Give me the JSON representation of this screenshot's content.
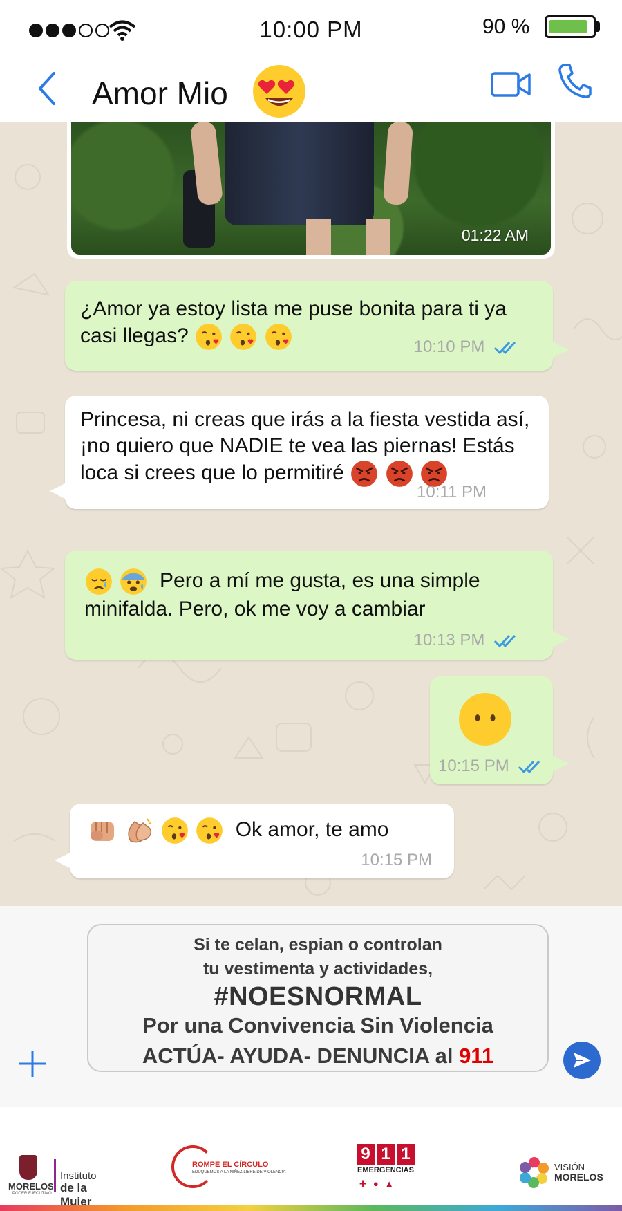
{
  "status_bar": {
    "time": "10:00 PM",
    "battery": "90 %",
    "battery_level": 0.9,
    "signal_bars_filled": 3,
    "signal_bars_total": 5
  },
  "header": {
    "contact_name": "Amor Mio",
    "contact_emoji": "heart-eyes-emoji"
  },
  "colors": {
    "accent": "#2c7be5",
    "outgoing_bubble": "#dcf7c5",
    "incoming_bubble": "#ffffff",
    "chat_background": "#e9e2d5",
    "read_ticks": "#3b9ae1",
    "highlight_red": "#e10000"
  },
  "messages": [
    {
      "type": "image",
      "direction": "in",
      "time": "01:22 AM"
    },
    {
      "direction": "out",
      "text": "¿Amor ya estoy lista me puse bonita para ti ya casi llegas?",
      "emojis": [
        "kiss-emoji",
        "kiss-emoji",
        "kiss-emoji"
      ],
      "time": "10:10 PM",
      "read": true
    },
    {
      "direction": "in",
      "text": "Princesa, ni creas que irás a la fiesta vestida así, ¡no quiero que NADIE te vea las piernas! Estás loca si crees que lo permitiré",
      "emojis": [
        "angry-emoji",
        "angry-emoji",
        "angry-emoji"
      ],
      "time": "10:11 PM"
    },
    {
      "direction": "out",
      "text": "Pero a mí me gusta, es una simple minifalda. Pero, ok me voy a cambiar",
      "emojis_before": [
        "sad-emoji",
        "anxious-emoji"
      ],
      "time": "10:13 PM",
      "read": true
    },
    {
      "direction": "out",
      "text": "",
      "emojis": [
        "no-mouth-emoji"
      ],
      "time": "10:15 PM",
      "read": true
    },
    {
      "direction": "in",
      "text": "Ok amor, te amo",
      "emojis_before": [
        "fist-emoji",
        "clap-emoji",
        "kiss-emoji",
        "kiss-emoji"
      ],
      "time": "10:15 PM"
    }
  ],
  "input": {
    "line1": "Si te celan, espian o controlan",
    "line2": "tu vestimenta y actividades,",
    "hashtag": "#NOESNORMAL",
    "line4": "Por una Convivencia Sin Violencia",
    "line5": "ACTÚA- AYUDA- DENUNCIA al",
    "number": "911"
  },
  "footer": {
    "morelos": {
      "label": "MORELOS",
      "sub": "PODER EJECUTIVO"
    },
    "instituto": {
      "line1": "Instituto",
      "line2": "de la Mujer"
    },
    "rompe": {
      "title": "ROMPE EL CÍRCULO",
      "sub": "EDUQUEMOS A LA NIÑEZ LIBRE DE VIOLENCIA"
    },
    "emergencias": {
      "digits": [
        "9",
        "1",
        "1"
      ],
      "label": "EMERGENCIAS"
    },
    "vision": {
      "line1": "VISIÓN",
      "line2": "MORELOS"
    }
  }
}
